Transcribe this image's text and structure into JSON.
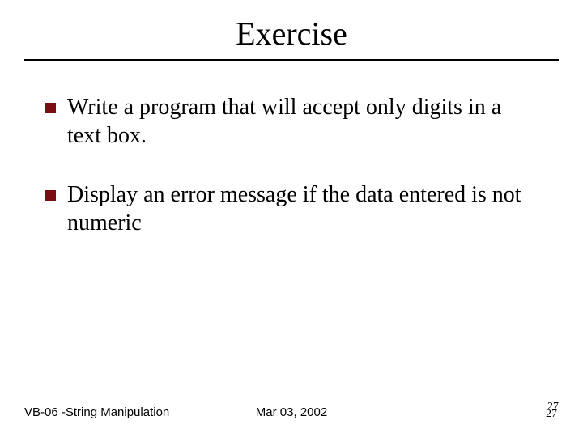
{
  "title": "Exercise",
  "bullets": [
    "Write a program that will accept only digits in a text box.",
    "Display an error message if the data entered is not numeric"
  ],
  "footer": {
    "left": "VB-06 -String Manipulation",
    "center": "Mar 03, 2002",
    "pageTop": "27",
    "pageBottom": "27"
  },
  "colors": {
    "bulletMarker": "#7b0e12"
  }
}
